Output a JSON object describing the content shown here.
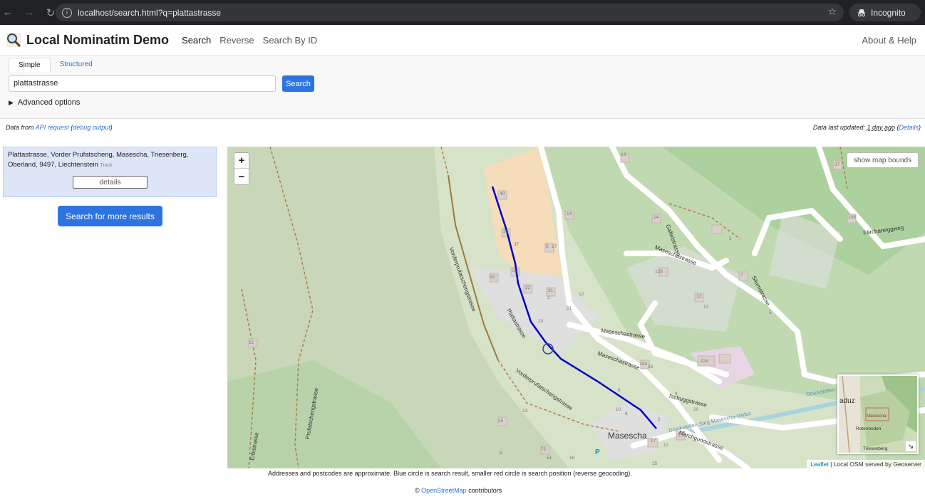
{
  "browser": {
    "url": "localhost/search.html?q=plattastrasse",
    "incognito_label": "Incognito"
  },
  "header": {
    "title": "Local Nominatim Demo",
    "nav": [
      "Search",
      "Reverse",
      "Search By ID"
    ],
    "about": "About & Help"
  },
  "search": {
    "tabs": [
      "Simple",
      "Structured"
    ],
    "query": "plattastrasse",
    "button": "Search",
    "advanced": "Advanced options"
  },
  "info": {
    "prefix": "Data from",
    "api_link": "API request",
    "debug_link": "debug output",
    "updated_prefix": "Data last updated:",
    "updated_value": "1 day ago",
    "details_link": "Details"
  },
  "results": [
    {
      "name": "Plattastrasse, Vorder Prufatscheng, Masescha, Triesenberg, Oberland, 9497, Liechtenstein",
      "type": "Track",
      "details_button": "details"
    }
  ],
  "more_results": "Search for more results",
  "map": {
    "zoom_in": "+",
    "zoom_out": "−",
    "bounds_button": "show map bounds",
    "labels": {
      "plattastrasse": "Plattastrasse",
      "vorder1": "Vorderprufatschengstrasse",
      "vorder2": "Vorderprufatschengstrasse",
      "prufatscheng": "Prufatschengstrasse",
      "erbi": "Erbistrasse",
      "maseschastrasse1": "Maseschastrasse",
      "maseschastrasse2": "Maseschastrasse",
      "maseschastrasse3": "Maseschastrasse",
      "gaflei": "Gafleistrasse",
      "silum": "Silumstrasse",
      "farchan": "Färchaneggweg",
      "tschugg": "Tschuggstrasse",
      "marchgu": "Marchgundstrasse",
      "druck": "Druckstollen Steg Masescha-Vaduz",
      "druck2": "Druckstollen",
      "masescha": "Masescha"
    },
    "house_numbers": [
      "40",
      "35",
      "37",
      "32",
      "30",
      "22",
      "31",
      "20",
      "2",
      "5",
      "17",
      "14",
      "12",
      "21",
      "128",
      "13",
      "124",
      "108",
      "12",
      "13",
      "14",
      "5",
      "7",
      "6",
      "8",
      "9",
      "35",
      "75",
      "51",
      "17",
      "15",
      "25",
      "22",
      "8",
      "13",
      "16",
      "10",
      "5",
      "37",
      "108",
      "26",
      "20",
      "2",
      "17"
    ],
    "minimap_labels": [
      "aduz",
      "Masescha",
      "Rotenboden",
      "Triesenberg"
    ],
    "attribution_leaflet": "Leaflet",
    "attribution_rest": "| Local OSM served by Geoserver"
  },
  "footer": {
    "note": "Addresses and postcodes are approximate. Blue circle is search result, smaller red circle is search position (reverse geocoding).",
    "copy_symbol": "©",
    "osm_link": "OpenStreetMap",
    "copy_rest": "contributors"
  }
}
